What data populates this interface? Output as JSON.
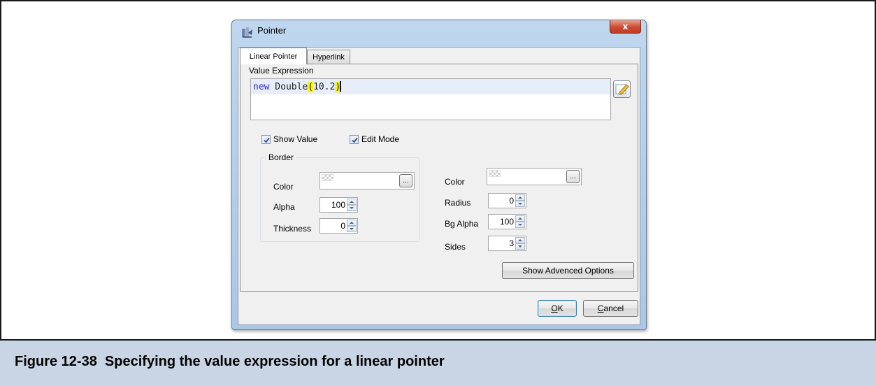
{
  "dialog": {
    "title": "Pointer",
    "close_label": "x"
  },
  "tabs": [
    {
      "label": "Linear Pointer",
      "active": true
    },
    {
      "label": "Hyperlink",
      "active": false
    }
  ],
  "value_expression": {
    "label": "Value Expression",
    "keyword": "new",
    "class_name": " Double",
    "open_paren": "(",
    "number": "10.2",
    "close_paren": ")"
  },
  "checkboxes": {
    "show_value": {
      "label": "Show Value",
      "checked": true
    },
    "edit_mode": {
      "label": "Edit Mode",
      "checked": true
    }
  },
  "border": {
    "group_label": "Border",
    "color_label": "Color",
    "alpha_label": "Alpha",
    "alpha_value": "100",
    "thickness_label": "Thickness",
    "thickness_value": "0"
  },
  "right_panel": {
    "color_label": "Color",
    "radius_label": "Radius",
    "radius_value": "0",
    "bg_alpha_label": "Bg Alpha",
    "bg_alpha_value": "100",
    "sides_label": "Sides",
    "sides_value": "3"
  },
  "buttons": {
    "advanced": "Show Advenced Options",
    "ellipsis": "...",
    "ok_mnemonic": "O",
    "ok_rest": "K",
    "cancel_mnemonic": "C",
    "cancel_rest": "ancel"
  },
  "caption": "Figure 12-38  Specifying the value expression for a linear pointer",
  "colors": {
    "caption_bg": "#c9d4e4",
    "keyword": "#2a2acf",
    "bracket_highlight": "#fcf50a"
  }
}
